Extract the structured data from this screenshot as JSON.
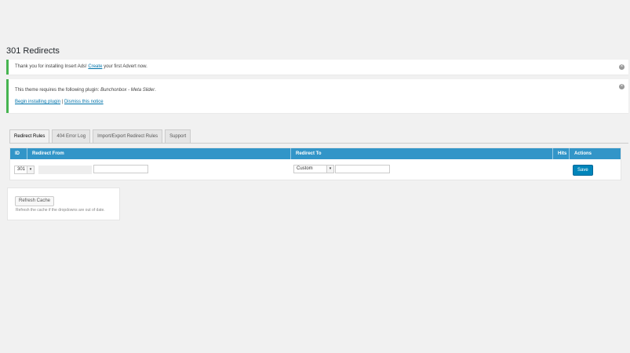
{
  "page": {
    "title": "301 Redirects"
  },
  "notices": {
    "first": {
      "before": "Thank you for installing Insert Ads! ",
      "link": "Create",
      "after": " your first Advert now."
    },
    "second": {
      "before": "This theme requires the following plugin: ",
      "plugin": "Bunchonbox - Meta Slider",
      "after": ".",
      "begin_link": "Begin installing plugin",
      "separator": " | ",
      "dismiss_link": "Dismiss this notice"
    },
    "dismiss_glyph": "×"
  },
  "tabs": [
    {
      "label": "Redirect Rules",
      "active": true
    },
    {
      "label": "404 Error Log",
      "active": false
    },
    {
      "label": "Import/Export Redirect Rules",
      "active": false
    },
    {
      "label": "Support",
      "active": false
    }
  ],
  "table": {
    "columns": {
      "id": "ID",
      "from": "Redirect From",
      "to": "Redirect To",
      "hits": "Hits",
      "actions": "Actions"
    },
    "row": {
      "status_value": "301",
      "redirect_to_type": "Custom",
      "save_label": "Save"
    }
  },
  "cache": {
    "button_label": "Refresh Cache",
    "help_text": "Refresh the cache if the dropdowns are out of date."
  },
  "colors": {
    "header_bg": "#3295c8",
    "notice_border": "#46b450",
    "primary_button": "#0085ba"
  }
}
